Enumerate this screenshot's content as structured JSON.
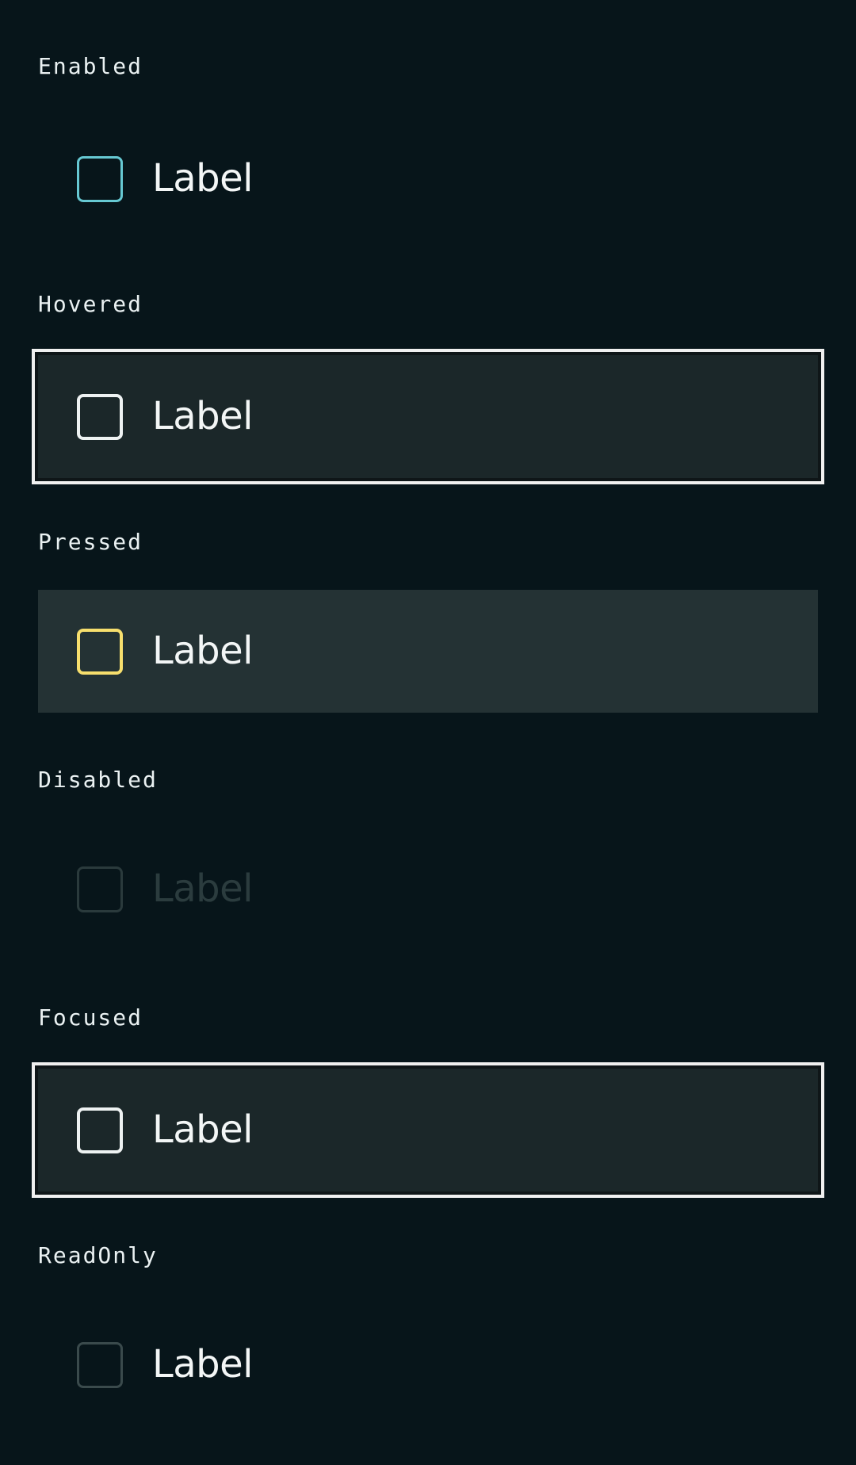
{
  "states": [
    {
      "key": "enabled",
      "title": "Enabled",
      "label": "Label"
    },
    {
      "key": "hovered",
      "title": "Hovered",
      "label": "Label"
    },
    {
      "key": "pressed",
      "title": "Pressed",
      "label": "Label"
    },
    {
      "key": "disabled",
      "title": "Disabled",
      "label": "Label"
    },
    {
      "key": "focused",
      "title": "Focused",
      "label": "Label"
    },
    {
      "key": "readonly",
      "title": "ReadOnly",
      "label": "Label"
    }
  ],
  "colors": {
    "background": "#07151a",
    "enabled_border": "#66c8d2",
    "pressed_border": "#f7df6d",
    "focus_ring": "#f0f0f0",
    "text": "#f3f6f6",
    "disabled_text": "#2b3c3e"
  }
}
